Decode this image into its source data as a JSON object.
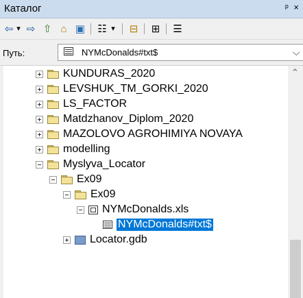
{
  "panel": {
    "title": "Каталог",
    "controls": "ᵖ ×"
  },
  "toolbar": {
    "buttons": [
      {
        "name": "back-button",
        "glyph": "⇦"
      },
      {
        "name": "back-dropdown-button",
        "glyph": "▾"
      },
      {
        "name": "forward-button",
        "glyph": "⇨"
      },
      {
        "name": "up-level-button",
        "glyph": "⇧"
      },
      {
        "name": "home-folder-button",
        "glyph": "⌂"
      },
      {
        "name": "connect-folder-button",
        "glyph": "▣"
      },
      {
        "name": "view-mode-button",
        "glyph": "☷"
      },
      {
        "name": "view-mode-dropdown",
        "glyph": "▾"
      },
      {
        "name": "disconnect-folder-button",
        "glyph": "⊟"
      },
      {
        "name": "toggle-tree-button",
        "glyph": "⊞"
      },
      {
        "name": "options-button",
        "glyph": "☰"
      }
    ]
  },
  "path": {
    "label": "Путь:",
    "value": "NYMcDonalds#txt$"
  },
  "tree": [
    {
      "label": "KUNDURAS_2020",
      "type": "folder",
      "expanded": false
    },
    {
      "label": "LEVSHUK_TM_GORKI_2020",
      "type": "folder",
      "expanded": false
    },
    {
      "label": "LS_FACTOR",
      "type": "folder",
      "expanded": false
    },
    {
      "label": "Matdzhanov_Diplom_2020",
      "type": "folder",
      "expanded": false
    },
    {
      "label": "MAZOLOVO AGROHIMIYA NOVAYA",
      "type": "folder",
      "expanded": false
    },
    {
      "label": "modelling",
      "type": "folder",
      "expanded": false
    },
    {
      "label": "Myslyva_Locator",
      "type": "folder",
      "expanded": true
    },
    {
      "label": "Ex09",
      "type": "folder",
      "expanded": true
    },
    {
      "label": "Ex09",
      "type": "folder",
      "expanded": true
    },
    {
      "label": "NYMcDonalds.xls",
      "type": "xls",
      "expanded": true
    },
    {
      "label": "NYMcDonalds#txt$",
      "type": "table",
      "selected": true
    },
    {
      "label": "Locator.gdb",
      "type": "gdb",
      "expanded": false
    }
  ]
}
